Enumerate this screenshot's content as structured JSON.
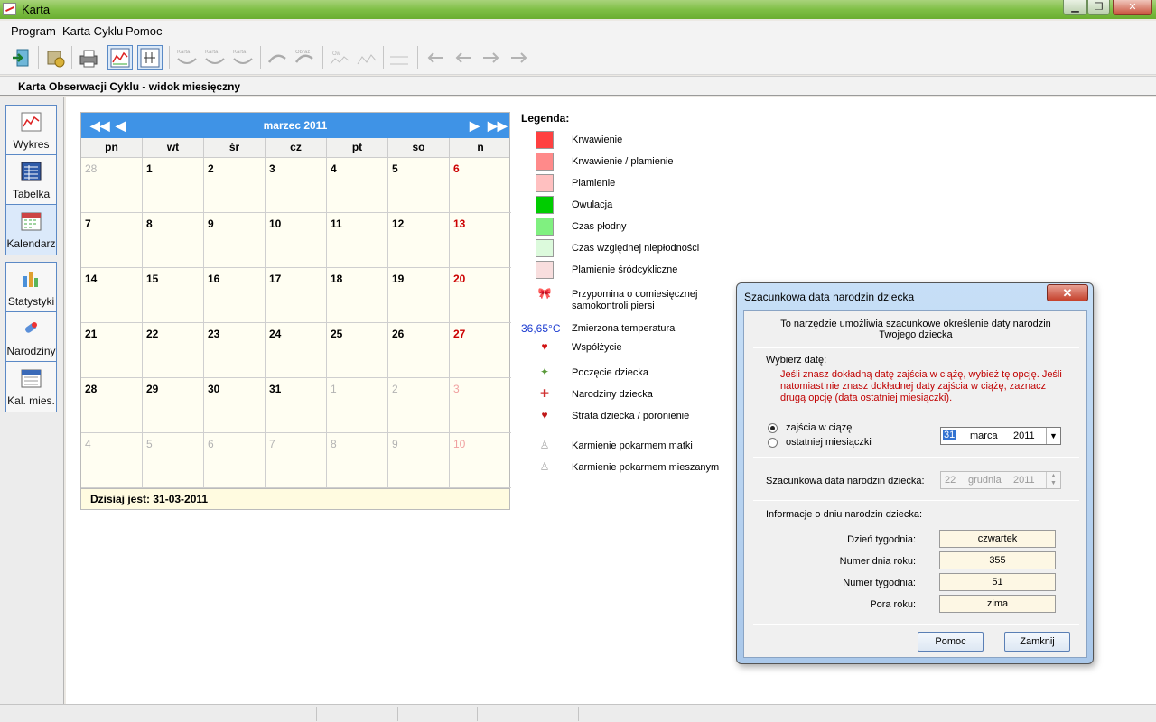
{
  "window": {
    "title": "Karta",
    "minimize": "▁",
    "restore": "❐",
    "close": "✕"
  },
  "menu": [
    "Program",
    "Karta Cyklu",
    "Pomoc"
  ],
  "toolbar": {
    "icons": [
      "exit-icon",
      "settings-icon",
      "print-icon",
      "chart-icon",
      "table-icon",
      "karta-icon",
      "karta-icon",
      "karta-icon",
      "hands-icon",
      "hands-icon",
      "chart-small-icon",
      "chart-small-icon",
      "chart-small-icon",
      "arrow-icon",
      "arrow-icon",
      "arrow-icon",
      "arrow-icon"
    ],
    "labels": {
      "karta": "Karta",
      "obraz": "Obraz",
      "ow": "Ow"
    }
  },
  "view_title": "Karta Obserwacji Cyklu - widok miesięczny",
  "sidebar": {
    "group1": [
      {
        "label": "Wykres",
        "icon": "chart-icon",
        "active": false
      },
      {
        "label": "Tabelka",
        "icon": "table-icon",
        "active": false
      },
      {
        "label": "Kalendarz",
        "icon": "calendar-icon",
        "active": true
      }
    ],
    "group2": [
      {
        "label": "Statystyki",
        "icon": "statistics-icon",
        "active": false
      },
      {
        "label": "Narodziny",
        "icon": "baby-icon",
        "active": false
      },
      {
        "label": "Kal. mies.",
        "icon": "calendar-month-icon",
        "active": false
      }
    ]
  },
  "calendar": {
    "month_label": "marzec 2011",
    "nav": {
      "prev_year": "◀◀",
      "prev": "◀",
      "next": "▶",
      "next_year": "▶▶"
    },
    "weekdays": [
      "pn",
      "wt",
      "śr",
      "cz",
      "pt",
      "so",
      "n"
    ],
    "days": [
      [
        "28",
        "1",
        "2",
        "3",
        "4",
        "5",
        "6"
      ],
      [
        "7",
        "8",
        "9",
        "10",
        "11",
        "12",
        "13"
      ],
      [
        "14",
        "15",
        "16",
        "17",
        "18",
        "19",
        "20"
      ],
      [
        "21",
        "22",
        "23",
        "24",
        "25",
        "26",
        "27"
      ],
      [
        "28",
        "29",
        "30",
        "31",
        "1",
        "2",
        "3"
      ],
      [
        "4",
        "5",
        "6",
        "7",
        "8",
        "9",
        "10"
      ]
    ],
    "today_label": "Dzisiaj jest: 31-03-2011"
  },
  "legend": {
    "title": "Legenda:",
    "items": [
      {
        "label": "Krwawienie",
        "color": "#ff4040"
      },
      {
        "label": "Krwawienie / plamienie",
        "color": "#ff8a8a"
      },
      {
        "label": "Plamienie",
        "color": "#ffc0c0"
      },
      {
        "label": "Owulacja",
        "color": "#00cc00"
      },
      {
        "label": "Czas płodny",
        "color": "#80f080"
      },
      {
        "label": "Czas względnej niepłodności",
        "color": "#dcfadc"
      },
      {
        "label": "Plamienie śródcykliczne",
        "color": "#f8dede"
      }
    ],
    "icon_items": [
      {
        "label": "Przypomina o comiesięcznej samokontroli piersi",
        "icon": "ribbon-icon",
        "glyph": "🎀"
      },
      {
        "label": "Zmierzona temperatura",
        "icon": "temperature-text",
        "glyph": "36,65°C"
      },
      {
        "label": "Współżycie",
        "icon": "heart-icon",
        "glyph": "♥"
      },
      {
        "label": "Poczęcie dziecka",
        "icon": "conception-icon",
        "glyph": "✦"
      },
      {
        "label": "Narodziny dziecka",
        "icon": "birth-icon",
        "glyph": "✚"
      },
      {
        "label": "Strata dziecka / poronienie",
        "icon": "loss-icon",
        "glyph": "♥"
      },
      {
        "label": "Karmienie pokarmem matki",
        "icon": "bottle-icon",
        "glyph": "♙"
      },
      {
        "label": "Karmienie pokarmem mieszanym",
        "icon": "bottle-icon",
        "glyph": "♙"
      }
    ]
  },
  "dialog": {
    "title": "Szacunkowa data narodzin dziecka",
    "close": "✕",
    "intro": "To narzędzie umożliwia szacunkowe określenie daty narodzin Twojego dziecka",
    "choose_label": "Wybierz datę:",
    "hint": "Jeśli znasz dokładną datę zajścia w ciążę, wybież tę opcję. Jeśli natomiast nie znasz dokładnej daty zajścia w ciążę, zaznacz drugą opcję (data ostatniej miesiączki).",
    "options": [
      "zajścia w ciążę",
      "ostatniej miesiączki"
    ],
    "selected_option": 0,
    "date_input": {
      "day": "31",
      "month": "marca",
      "year": "2011"
    },
    "estimate_label": "Szacunkowa data narodzin dziecka:",
    "estimate": {
      "day": "22",
      "month": "grudnia",
      "year": "2011"
    },
    "info_label": "Informacje o dniu narodzin dziecka:",
    "info": [
      {
        "label": "Dzień tygodnia:",
        "value": "czwartek"
      },
      {
        "label": "Numer dnia roku:",
        "value": "355"
      },
      {
        "label": "Numer tygodnia:",
        "value": "51"
      },
      {
        "label": "Pora roku:",
        "value": "zima"
      }
    ],
    "buttons": {
      "help": "Pomoc",
      "close": "Zamknij"
    }
  }
}
